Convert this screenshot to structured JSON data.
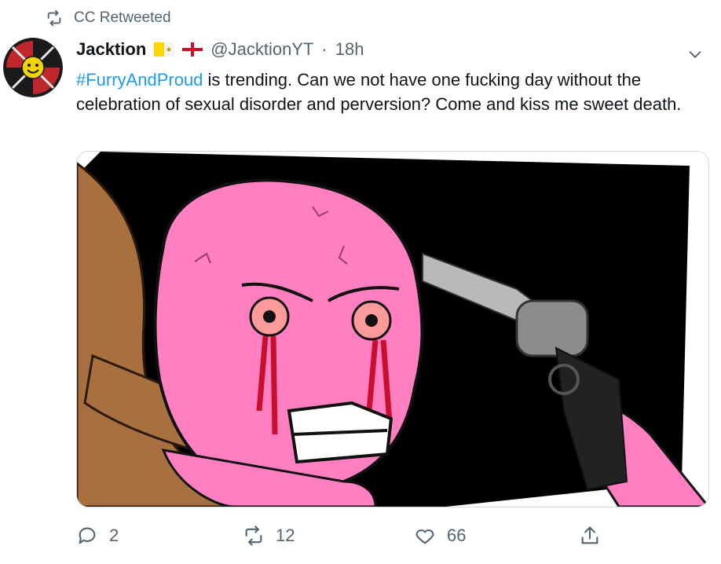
{
  "retweet": {
    "icon": "retweet-icon",
    "label": "CC Retweeted"
  },
  "author": {
    "name": "Jacktion",
    "handle": "@JacktionYT",
    "separator": "·",
    "time": "18h",
    "flags": [
      "vatican-flag-icon",
      "england-flag-icon"
    ]
  },
  "tweet": {
    "hashtag": "#FurryAndProud",
    "text": " is trending. Can we not have one fucking day without the celebration of sexual disorder and perversion? Come and kiss me sweet death."
  },
  "actions": {
    "reply_count": "2",
    "retweet_count": "12",
    "like_count": "66"
  },
  "colors": {
    "link": "#1d9bf0",
    "muted": "#536471",
    "text": "#0f1419",
    "border": "#cfd9de"
  }
}
